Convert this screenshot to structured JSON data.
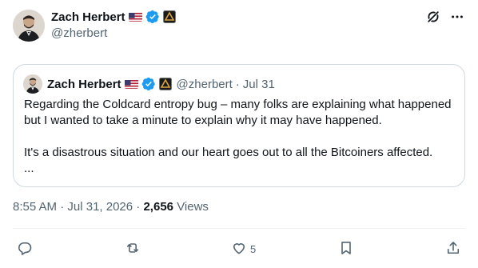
{
  "tweet": {
    "author_name": "Zach Herbert",
    "author_handle": "@zherbert",
    "timestamp": "8:55 AM",
    "date": "Jul 31, 2026",
    "separator": "·",
    "views_count": "2,656",
    "views_label": "Views"
  },
  "quoted": {
    "author_name": "Zach Herbert",
    "author_handle": "@zherbert",
    "separator": "·",
    "date": "Jul 31",
    "text_line1": "Regarding the Coldcard entropy bug – many folks are explaining what happened but I wanted to take a minute to explain why it may have happened.",
    "text_line2": "It's a disastrous situation and our heart goes out to all the Bitcoiners affected.",
    "ellipsis": "..."
  },
  "actions": {
    "reply_count": "",
    "repost_count": "",
    "like_count": "5",
    "bookmark_count": ""
  },
  "icons": {
    "flag": "us-flag-icon",
    "verified": "verified-badge-icon",
    "affiliation": "affiliation-badge-icon",
    "grok": "grok-icon",
    "more": "more-icon",
    "reply": "reply-icon",
    "repost": "repost-icon",
    "like": "like-icon",
    "bookmark": "bookmark-icon",
    "share": "share-icon"
  },
  "colors": {
    "text_primary": "#0f1419",
    "text_secondary": "#536471",
    "verified_blue": "#1d9bf0",
    "border": "#cfd9de",
    "divider": "#eff3f4"
  }
}
